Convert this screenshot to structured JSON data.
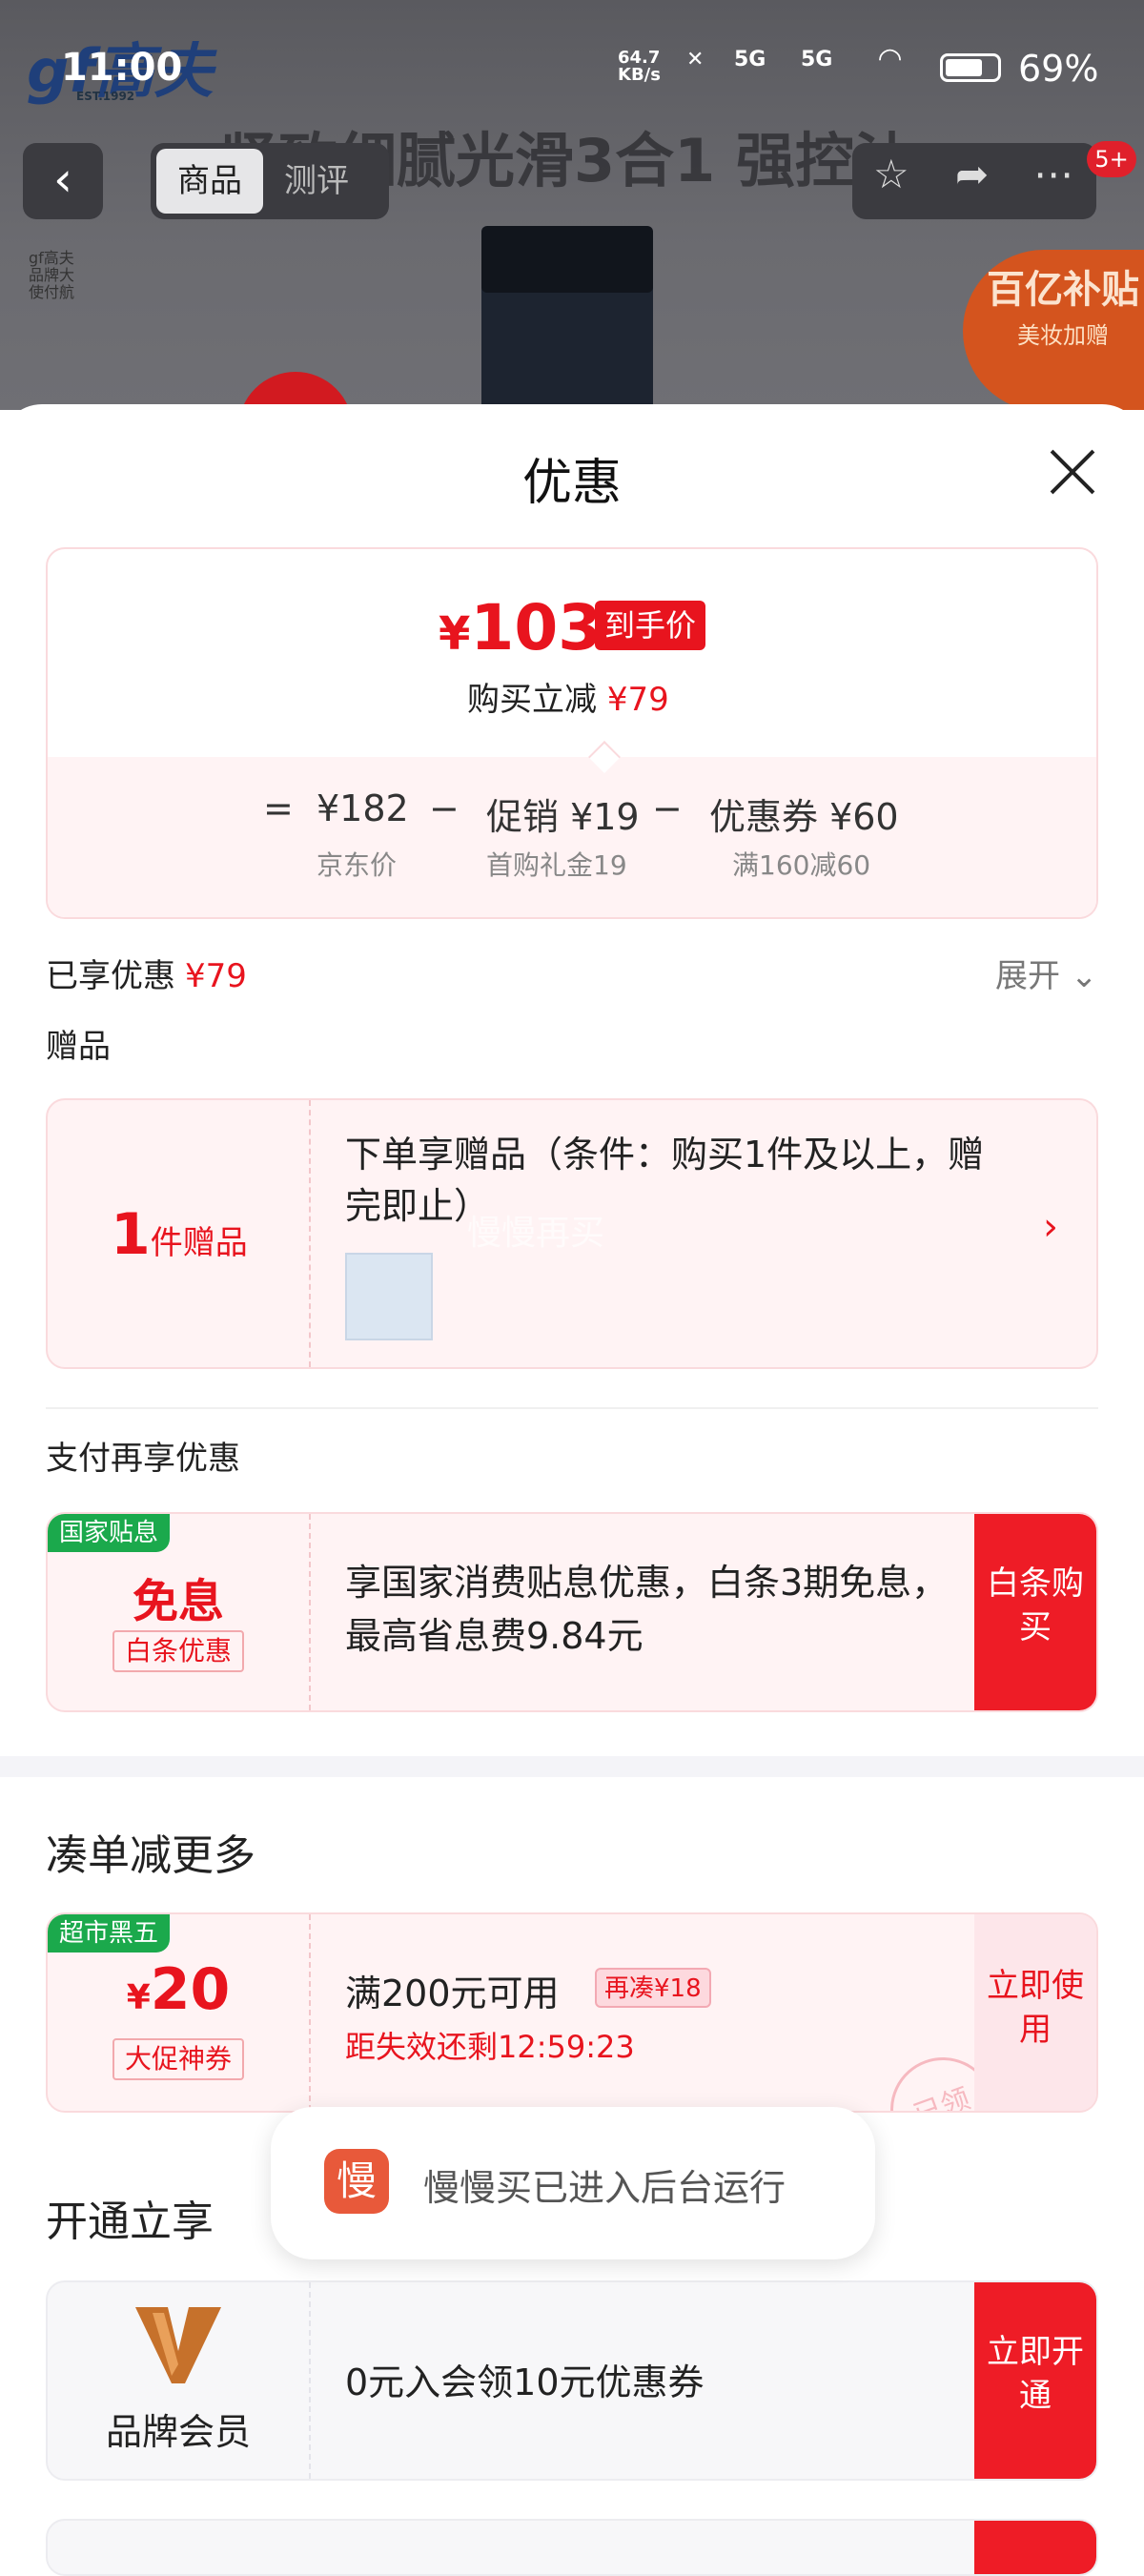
{
  "status": {
    "time": "11:00",
    "net_speed_top": "64.7",
    "net_speed_unit": "KB/s",
    "signal1": "5G",
    "signal2": "5G",
    "battery": "69%"
  },
  "background": {
    "brand_logo": "gf高夫",
    "brand_est": "EST.1992",
    "headline": "紧致细腻光滑3合1 强控油",
    "side_text": "gf高夫品牌大使付航",
    "promo_badge_line1": "百亿补贴",
    "promo_badge_line2": "美妆加赠"
  },
  "nav": {
    "tab_product": "商品",
    "tab_review": "测评",
    "cart_badge": "5+"
  },
  "sheet": {
    "title": "优惠",
    "price": {
      "currency": "¥",
      "final": "103",
      "final_tag": "到手价",
      "reduce_label": "购买立减",
      "reduce_value": "¥79"
    },
    "formula": {
      "eq": "=",
      "jd_price": "¥182",
      "jd_label": "京东价",
      "minus1": "−",
      "promo": "促销 ¥19",
      "promo_label": "首购礼金19",
      "minus2": "−",
      "coupon": "优惠券 ¥60",
      "coupon_label": "满160减60"
    },
    "enjoyed": {
      "label": "已享优惠",
      "value": "¥79",
      "expand": "展开"
    },
    "gift": {
      "section": "赠品",
      "count": "1",
      "count_label": "件赠品",
      "desc": "下单享赠品（条件：购买1件及以上，赠完即止）",
      "watermark": "慢慢再买"
    },
    "pay": {
      "section": "支付再享优惠",
      "corner": "国家贴息",
      "main": "免息",
      "sub": "白条优惠",
      "desc": "享国家消费贴息优惠，白条3期免息，最高省息费9.84元",
      "btn": "白条购买"
    },
    "more": {
      "section": "凑单减更多",
      "corner": "超市黑五",
      "currency": "¥",
      "amount": "20",
      "sub": "大促神券",
      "cond": "满200元可用",
      "tag": "再凑¥18",
      "countdown": "距失效还剩12:59:23",
      "btn": "立即使用",
      "stamp": "已领"
    },
    "open": {
      "section": "开通立享",
      "member_label": "品牌会员",
      "desc": "0元入会领10元优惠券",
      "btn": "立即开通"
    }
  },
  "toast": {
    "icon_char": "慢",
    "text": "慢慢买已进入后台运行"
  }
}
